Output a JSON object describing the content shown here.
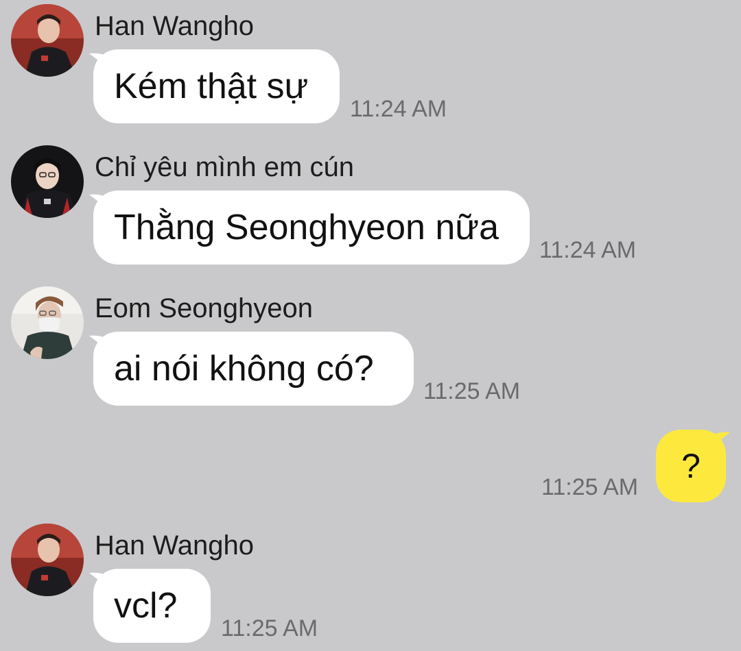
{
  "messages": [
    {
      "sender": "Han Wangho",
      "text": "Kém thật sự",
      "time": "11:24 AM",
      "avatar": "player-photo-red-jersey"
    },
    {
      "sender": "Chỉ yêu mình em cún",
      "text": "Thằng Seonghyeon nữa",
      "time": "11:24 AM",
      "avatar": "player-photo-dark-jersey"
    },
    {
      "sender": "Eom Seonghyeon",
      "text": "ai nói không có?",
      "time": "11:25 AM",
      "avatar": "player-photo-face-mask"
    },
    {
      "sender": "Han Wangho",
      "text": "vcl?",
      "time": "11:25 AM",
      "avatar": "player-photo-red-jersey"
    }
  ],
  "outgoing": {
    "text": "?",
    "time": "11:25 AM"
  },
  "colors": {
    "background": "#c9c9cb",
    "incoming_bubble": "#ffffff",
    "outgoing_bubble": "#fde93e",
    "timestamp": "#6a6a6e"
  }
}
